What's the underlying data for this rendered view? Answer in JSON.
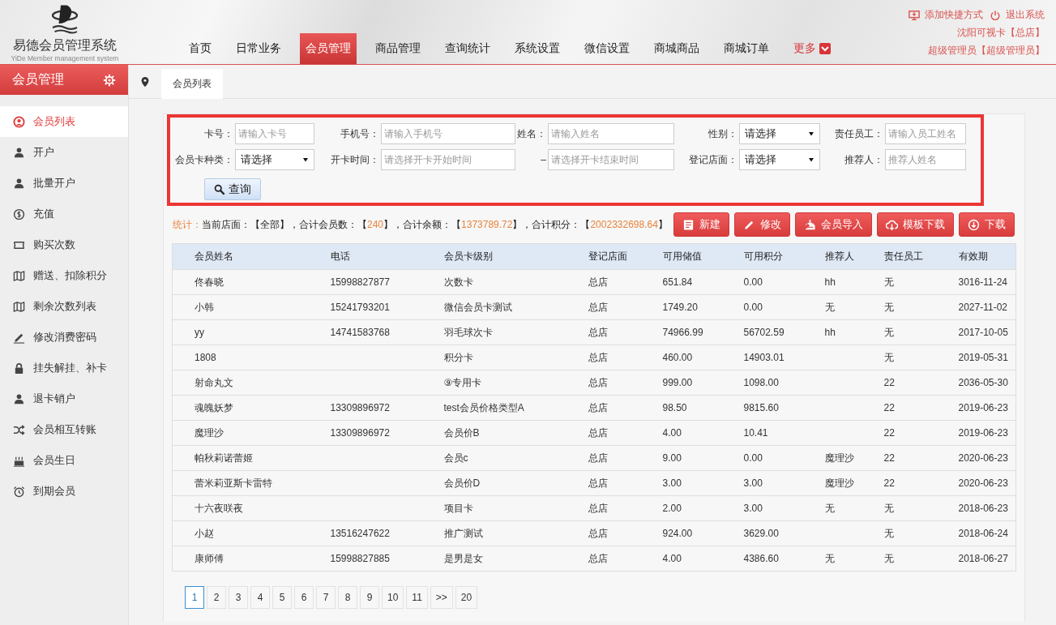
{
  "header": {
    "logo_title": "易德会员管理系统",
    "logo_subtitle": "YiDe Member management system",
    "nav": [
      {
        "label": "首页",
        "selected": false,
        "kind": "item"
      },
      {
        "label": "日常业务",
        "selected": false,
        "kind": "item"
      },
      {
        "label": "会员管理",
        "selected": true,
        "kind": "item"
      },
      {
        "label": "商品管理",
        "selected": false,
        "kind": "item"
      },
      {
        "label": "查询统计",
        "selected": false,
        "kind": "item"
      },
      {
        "label": "系统设置",
        "selected": false,
        "kind": "item"
      },
      {
        "label": "微信设置",
        "selected": false,
        "kind": "item"
      },
      {
        "label": "商城商品",
        "selected": false,
        "kind": "item"
      },
      {
        "label": "商城订单",
        "selected": false,
        "kind": "item"
      },
      {
        "label": "更多",
        "selected": false,
        "kind": "more"
      }
    ],
    "links": [
      {
        "label": "添加快捷方式"
      },
      {
        "label": "退出系统"
      }
    ],
    "user_lines": [
      "沈阳可视卡【总店】",
      "超级管理员【超级管理员】"
    ]
  },
  "sidebar": {
    "title": "会员管理",
    "items": [
      {
        "label": "会员列表",
        "selected": true
      },
      {
        "label": "开户",
        "selected": false
      },
      {
        "label": "批量开户",
        "selected": false
      },
      {
        "label": "充值",
        "selected": false
      },
      {
        "label": "购买次数",
        "selected": false
      },
      {
        "label": "赠送、扣除积分",
        "selected": false
      },
      {
        "label": "剩余次数列表",
        "selected": false
      },
      {
        "label": "修改消费密码",
        "selected": false
      },
      {
        "label": "挂失解挂、补卡",
        "selected": false
      },
      {
        "label": "退卡销户",
        "selected": false
      },
      {
        "label": "会员相互转账",
        "selected": false
      },
      {
        "label": "会员生日",
        "selected": false
      },
      {
        "label": "到期会员",
        "selected": false
      }
    ]
  },
  "breadcrumb_tabs": [
    {
      "label": "会员列表",
      "selected": true
    }
  ],
  "search": {
    "fields": [
      {
        "label": "卡号：",
        "kind": "text",
        "placeholder": "请输入卡号"
      },
      {
        "label": "手机号：",
        "kind": "text",
        "placeholder": "请输入手机号"
      },
      {
        "label": "姓名：",
        "kind": "text",
        "placeholder": "请输入姓名"
      },
      {
        "label": "性别：",
        "kind": "select",
        "value": "请选择"
      },
      {
        "label": "责任员工：",
        "kind": "text",
        "placeholder": "请输入员工姓名"
      },
      {
        "label": "会员卡种类：",
        "kind": "select",
        "value": "请选择"
      },
      {
        "label": "开卡时间：",
        "kind": "text",
        "placeholder": "请选择开卡开始时间"
      },
      {
        "label": "–",
        "kind": "text",
        "placeholder": "请选择开卡结束时间"
      },
      {
        "label": "登记店面：",
        "kind": "select",
        "value": "请选择"
      },
      {
        "label": "推荐人：",
        "kind": "text",
        "placeholder": "推荐人姓名"
      }
    ],
    "button": "查询"
  },
  "stats": {
    "label": "统计：",
    "parts": [
      {
        "text": "当前店面：【全部】，",
        "highlight": false
      },
      {
        "text": "合计会员数：【",
        "highlight": false
      },
      {
        "text": "240",
        "highlight": true
      },
      {
        "text": "】，",
        "highlight": false
      },
      {
        "text": "合计余额：【",
        "highlight": false
      },
      {
        "text": "1373789.72",
        "highlight": true
      },
      {
        "text": "】，",
        "highlight": false
      },
      {
        "text": "合计积分：【",
        "highlight": false
      },
      {
        "text": "2002332698.64",
        "highlight": true
      },
      {
        "text": "】",
        "highlight": false
      }
    ]
  },
  "actions": [
    "新建",
    "修改",
    "会员导入",
    "模板下载",
    "下载"
  ],
  "table": {
    "columns": [
      "会员姓名",
      "电话",
      "会员卡级别",
      "登记店面",
      "可用储值",
      "可用积分",
      "推荐人",
      "责任员工",
      "有效期"
    ],
    "rows": [
      [
        "佟春晓",
        "15998827877",
        "次数卡",
        "总店",
        "651.84",
        "0.00",
        "hh",
        "无",
        "3016-11-24"
      ],
      [
        "小韩",
        "15241793201",
        "微信会员卡测试",
        "总店",
        "1749.20",
        "0.00",
        "无",
        "无",
        "2027-11-02"
      ],
      [
        "yy",
        "14741583768",
        "羽毛球次卡",
        "总店",
        "74966.99",
        "56702.59",
        "hh",
        "无",
        "2017-10-05"
      ],
      [
        "1808",
        null,
        "积分卡",
        "总店",
        "460.00",
        "14903.01",
        null,
        "无",
        "2019-05-31"
      ],
      [
        "射命丸文",
        null,
        "⑨专用卡",
        "总店",
        "999.00",
        "1098.00",
        null,
        "22",
        "2036-05-30"
      ],
      [
        "魂魄妖梦",
        "13309896972",
        "test会员价格类型A",
        "总店",
        "98.50",
        "9815.60",
        null,
        "22",
        "2019-06-23"
      ],
      [
        "魔理沙",
        "13309896972",
        "会员价B",
        "总店",
        "4.00",
        "10.41",
        null,
        "22",
        "2019-06-23"
      ],
      [
        "帕秋莉诺蕾姬",
        null,
        "会员c",
        "总店",
        "9.00",
        "0.00",
        "魔理沙",
        "22",
        "2020-06-23"
      ],
      [
        "蕾米莉亚斯卡雷特",
        null,
        "会员价D",
        "总店",
        "3.00",
        "3.00",
        "魔理沙",
        "22",
        "2020-06-23"
      ],
      [
        "十六夜咲夜",
        null,
        "项目卡",
        "总店",
        "2.00",
        "3.00",
        "无",
        "无",
        "2018-06-23"
      ],
      [
        "小赵",
        "13516247622",
        "推广测试",
        "总店",
        "924.00",
        "3629.00",
        null,
        "无",
        "2018-06-24"
      ],
      [
        "康师傅",
        "15998827885",
        "是男是女",
        "总店",
        "4.00",
        "4386.60",
        "无",
        "无",
        "2018-06-27"
      ]
    ]
  },
  "pagination": [
    {
      "label": "1",
      "selected": true
    },
    {
      "label": "2",
      "selected": false
    },
    {
      "label": "3",
      "selected": false
    },
    {
      "label": "4",
      "selected": false
    },
    {
      "label": "5",
      "selected": false
    },
    {
      "label": "6",
      "selected": false
    },
    {
      "label": "7",
      "selected": false
    },
    {
      "label": "8",
      "selected": false
    },
    {
      "label": "9",
      "selected": false
    },
    {
      "label": "10",
      "selected": false
    },
    {
      "label": "11",
      "selected": false
    },
    {
      "label": ">>",
      "selected": false
    },
    {
      "label": "20",
      "selected": false
    }
  ]
}
